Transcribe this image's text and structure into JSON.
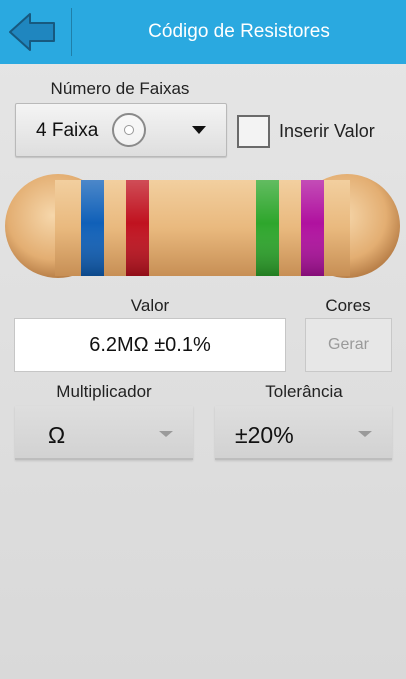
{
  "header": {
    "title": "Código de Resistores",
    "back_icon": "back-arrow-icon",
    "bar_color": "#2aa9e0"
  },
  "bands": {
    "label": "Número de Faixas",
    "selected": "4 Faixas",
    "selected_visible": "4 Faixa"
  },
  "insert_value": {
    "label": "Inserir Valor",
    "checked": false
  },
  "resistor": {
    "body_color": "#e9b97e",
    "band_colors": [
      "#1060b8",
      "#c0121f",
      "#2ea62c",
      "#b0119f"
    ]
  },
  "value": {
    "label": "Valor",
    "text": "6.2MΩ ±0.1%"
  },
  "colors": {
    "label": "Cores",
    "button_label": "Gerar",
    "enabled": false
  },
  "multiplier": {
    "label": "Multiplicador",
    "selected": "Ω"
  },
  "tolerance": {
    "label": "Tolerância",
    "selected": "±20%"
  }
}
